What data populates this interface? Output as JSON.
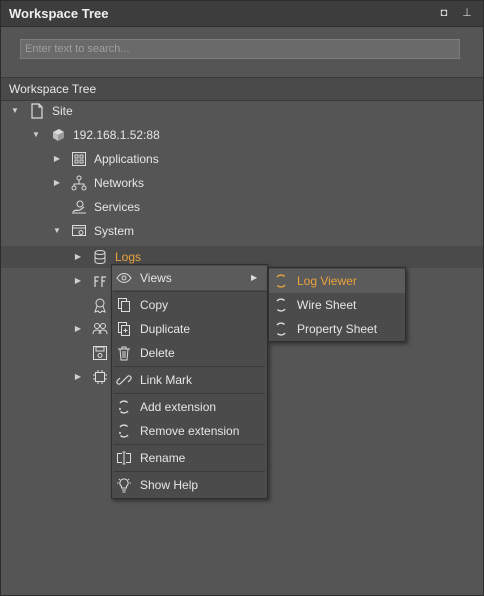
{
  "panel": {
    "title": "Workspace Tree",
    "maximize_glyph": "◘",
    "pin_glyph": "⊥"
  },
  "search": {
    "placeholder": "Enter text to search..."
  },
  "tree_header": {
    "label": "Workspace Tree"
  },
  "tree": {
    "site": "Site",
    "host": "192.168.1.52:88",
    "applications": "Applications",
    "networks": "Networks",
    "services": "Services",
    "system": "System",
    "logs": "Logs"
  },
  "context_menu": {
    "views": "Views",
    "copy": "Copy",
    "duplicate": "Duplicate",
    "delete": "Delete",
    "link_mark": "Link Mark",
    "add_extension": "Add extension",
    "remove_extension": "Remove extension",
    "rename": "Rename",
    "show_help": "Show Help"
  },
  "views_submenu": {
    "log_viewer": "Log Viewer",
    "wire_sheet": "Wire Sheet",
    "property_sheet": "Property Sheet"
  },
  "colors": {
    "accent": "#e8a33b",
    "panel_bg": "#555555",
    "menu_bg": "#4b4b4b"
  }
}
